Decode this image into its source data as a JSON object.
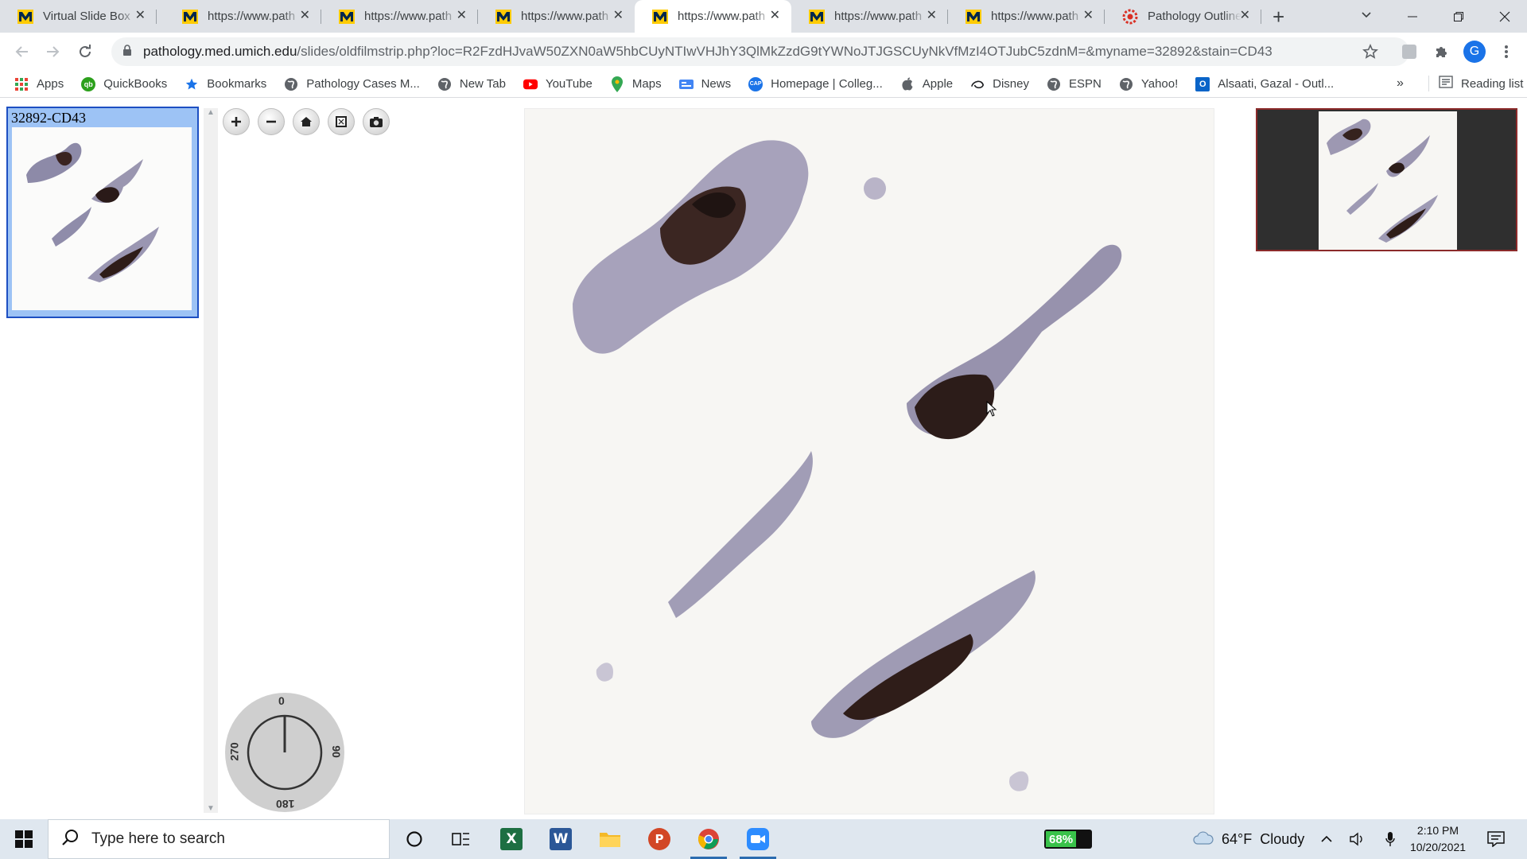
{
  "browser": {
    "tabs": [
      {
        "title": "Virtual Slide Box",
        "favicon": "umich-m-icon",
        "active": false
      },
      {
        "title": "https://www.path",
        "favicon": "umich-m-icon",
        "active": false
      },
      {
        "title": "https://www.path",
        "favicon": "umich-m-icon",
        "active": false
      },
      {
        "title": "https://www.path",
        "favicon": "umich-m-icon",
        "active": false
      },
      {
        "title": "https://www.path",
        "favicon": "umich-m-icon",
        "active": true
      },
      {
        "title": "https://www.path",
        "favicon": "umich-m-icon",
        "active": false
      },
      {
        "title": "https://www.path",
        "favicon": "umich-m-icon",
        "active": false
      },
      {
        "title": "Pathology Outline",
        "favicon": "gear-red-icon",
        "active": false
      }
    ],
    "url_host": "pathology.med.umich.edu",
    "url_path": "/slides/oldfilmstrip.php?loc=R2FzdHJvaW50ZXN0aW5hbCUyNTIwVHJhY3QlMkZzdG9tYWNoJTJGSCUyNkVfMzI4OTJubC5zdnM=&myname=32892&stain=CD43",
    "profile_initial": "G",
    "bookmarks": [
      {
        "label": "Apps",
        "icon": "apps-grid-icon"
      },
      {
        "label": "QuickBooks",
        "icon": "quickbooks-icon"
      },
      {
        "label": "Bookmarks",
        "icon": "star-icon"
      },
      {
        "label": "Pathology Cases M...",
        "icon": "globe-icon"
      },
      {
        "label": "New Tab",
        "icon": "globe-icon"
      },
      {
        "label": "YouTube",
        "icon": "youtube-icon"
      },
      {
        "label": "Maps",
        "icon": "maps-pin-icon"
      },
      {
        "label": "News",
        "icon": "news-icon"
      },
      {
        "label": "Homepage | Colleg...",
        "icon": "cap-icon"
      },
      {
        "label": "Apple",
        "icon": "apple-icon"
      },
      {
        "label": "Disney",
        "icon": "disney-icon"
      },
      {
        "label": "ESPN",
        "icon": "globe-icon"
      },
      {
        "label": "Yahoo!",
        "icon": "globe-icon"
      },
      {
        "label": "Alsaati, Gazal - Outl...",
        "icon": "outlook-icon"
      }
    ],
    "bookmarks_overflow": "»",
    "reading_list": "Reading list"
  },
  "viewer": {
    "slide_label": "32892-CD43",
    "rotation_degrees": 0,
    "dial_labels": {
      "top": "0",
      "right": "90",
      "bottom": "180",
      "left": "270"
    }
  },
  "taskbar": {
    "search_placeholder": "Type here to search",
    "battery": "68%",
    "battery_level": 0.68,
    "weather": "64°F  Cloudy",
    "time": "2:10 PM",
    "date": "10/20/2021"
  }
}
